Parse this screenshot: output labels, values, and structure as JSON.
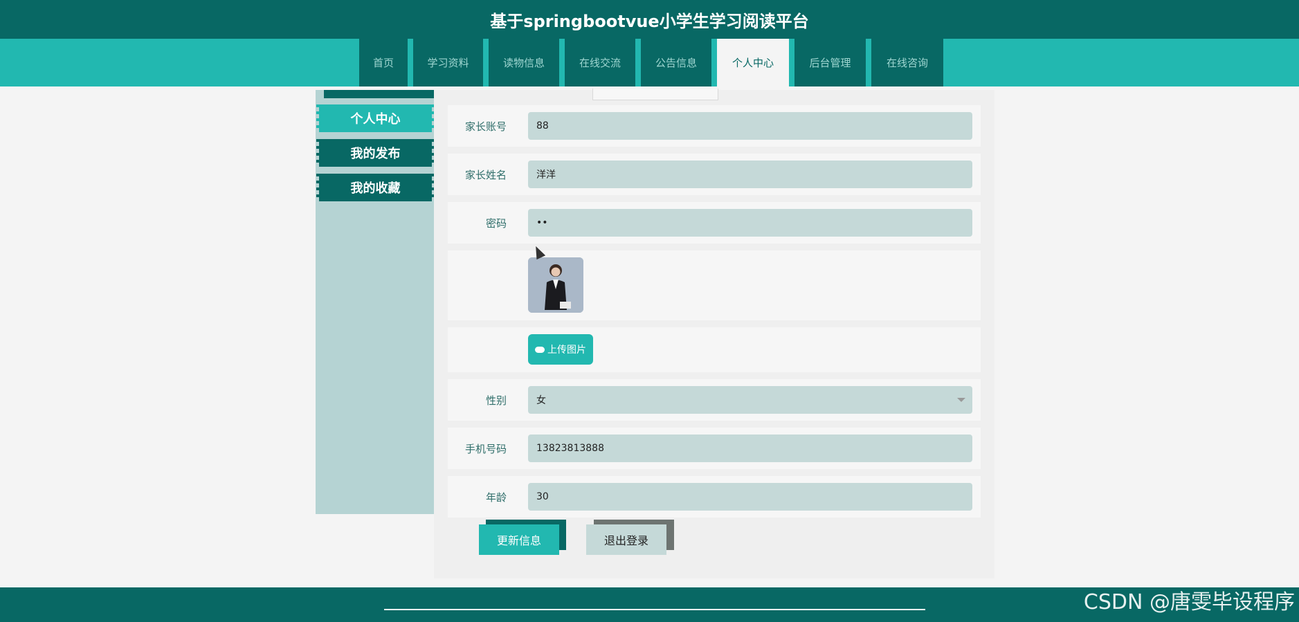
{
  "header": {
    "title": "基于springbootvue小学生学习阅读平台"
  },
  "nav": {
    "items": [
      {
        "label": "首页",
        "active": false
      },
      {
        "label": "学习资料",
        "active": false
      },
      {
        "label": "读物信息",
        "active": false
      },
      {
        "label": "在线交流",
        "active": false
      },
      {
        "label": "公告信息",
        "active": false
      },
      {
        "label": "个人中心",
        "active": true
      },
      {
        "label": "后台管理",
        "active": false
      },
      {
        "label": "在线咨询",
        "active": false
      }
    ]
  },
  "sidebar": {
    "items": [
      {
        "label": "个人中心",
        "active": true
      },
      {
        "label": "我的发布",
        "active": false
      },
      {
        "label": "我的收藏",
        "active": false
      }
    ]
  },
  "form": {
    "account": {
      "label": "家长账号",
      "value": "88"
    },
    "name": {
      "label": "家长姓名",
      "value": "洋洋"
    },
    "password": {
      "label": "密码",
      "value": "••"
    },
    "upload_label": "上传图片",
    "gender": {
      "label": "性别",
      "value": "女"
    },
    "phone": {
      "label": "手机号码",
      "value": "13823813888"
    },
    "age": {
      "label": "年龄",
      "value": "30"
    }
  },
  "actions": {
    "update_label": "更新信息",
    "logout_label": "退出登录"
  },
  "watermark": "CSDN @唐雯毕设程序",
  "colors": {
    "primary_dark": "#086864",
    "primary": "#22b8b0",
    "input_bg": "#c5d9d8",
    "sidebar_bg": "#b5d3d3"
  }
}
